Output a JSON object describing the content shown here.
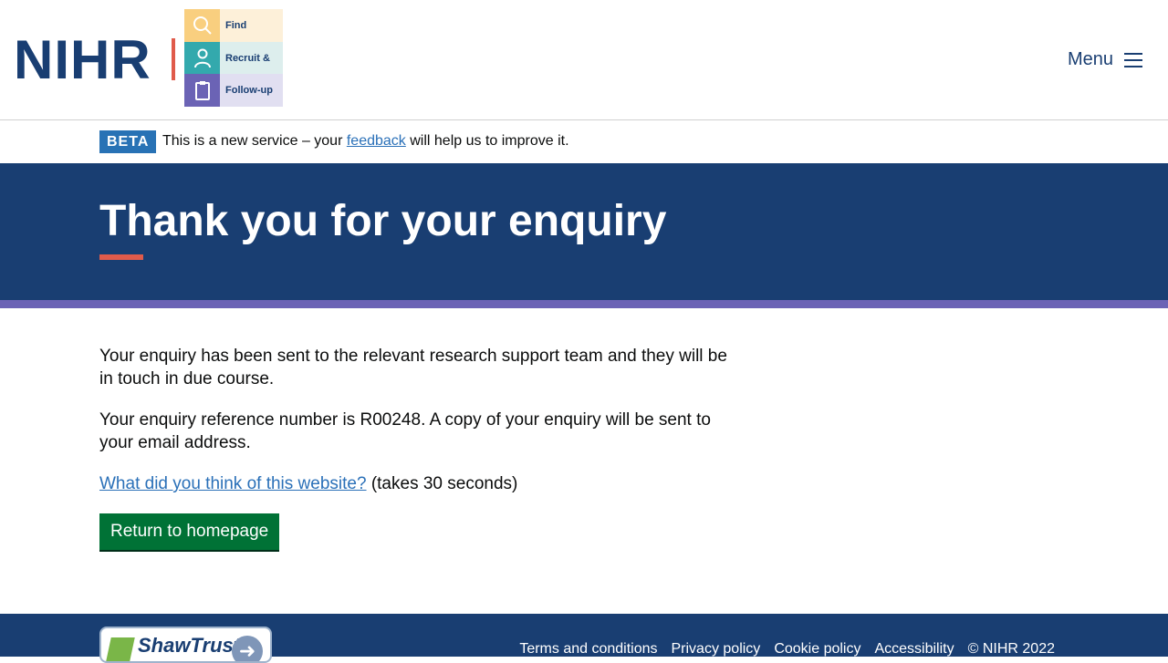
{
  "header": {
    "logo_text": "NIHR",
    "sub_logo": {
      "items": [
        {
          "label": "Find",
          "icon": "search-icon",
          "bg": "#fdf0d9",
          "icon_bg": "#f9cf7f"
        },
        {
          "label": "Recruit &",
          "icon": "person-icon",
          "bg": "#ddeeed",
          "icon_bg": "#33a9ad"
        },
        {
          "label": "Follow-up",
          "icon": "clipboard-icon",
          "bg": "#e1dff1",
          "icon_bg": "#6b63b5"
        }
      ]
    },
    "menu_label": "Menu"
  },
  "beta_banner": {
    "tag": "BETA",
    "text_before": "This is a new service – your ",
    "link_text": "feedback",
    "text_after": " will help us to improve it."
  },
  "hero": {
    "title": "Thank you for your enquiry"
  },
  "main": {
    "paragraph_1": "Your enquiry has been sent to the relevant research support team and they will be in touch in due course.",
    "paragraph_2": "Your enquiry reference number is R00248. A copy of your enquiry will be sent to your email address.",
    "survey_link": "What did you think of this website?",
    "survey_note": " (takes 30 seconds)",
    "button_label": "Return to homepage"
  },
  "footer": {
    "badge_text": "ShawTrust",
    "links": [
      "Terms and conditions",
      "Privacy policy",
      "Cookie policy",
      "Accessibility"
    ],
    "copyright": "© NIHR 2022"
  },
  "colors": {
    "navy": "#193e72",
    "accent_red": "#e05b4b",
    "purple": "#6b63b5",
    "link_blue": "#2a70b8",
    "button_green": "#007236",
    "beta_blue": "#2872b5"
  }
}
